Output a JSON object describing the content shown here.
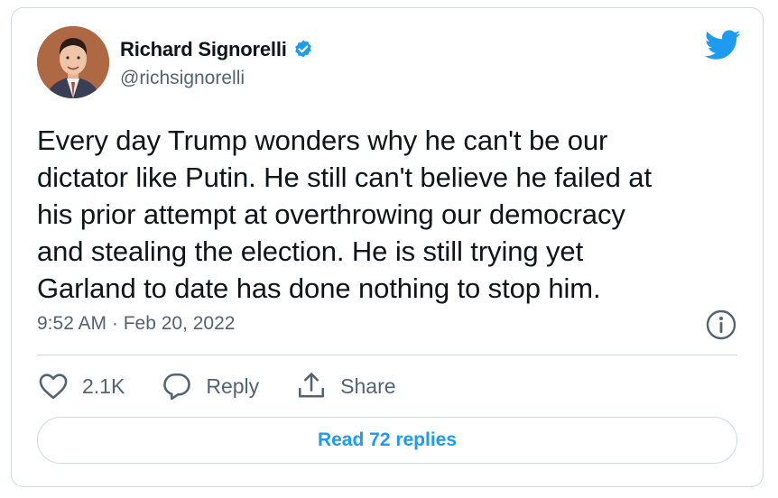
{
  "author": {
    "name": "Richard Signorelli",
    "handle": "@richsignorelli",
    "verified": true
  },
  "tweet": {
    "text": "Every day Trump wonders why he can't be our\ndictator like Putin. He still can't believe he failed at\nhis prior attempt at overthrowing our democracy\nand stealing the election. He is still trying yet\nGarland to date has done nothing to stop him.",
    "timestamp": "9:52 AM · Feb 20, 2022"
  },
  "actions": {
    "like_count": "2.1K",
    "reply_label": "Reply",
    "share_label": "Share"
  },
  "replies_button": {
    "label": "Read 72 replies"
  },
  "icons": {
    "bird": "twitter-bird-icon",
    "verified": "verified-badge-icon",
    "info": "info-icon",
    "like": "heart-icon",
    "reply": "speech-bubble-icon",
    "share": "share-upload-icon"
  },
  "colors": {
    "brand": "#1d9bf0",
    "text": "#0f1419",
    "muted": "#536471",
    "border": "#cfd9de"
  }
}
